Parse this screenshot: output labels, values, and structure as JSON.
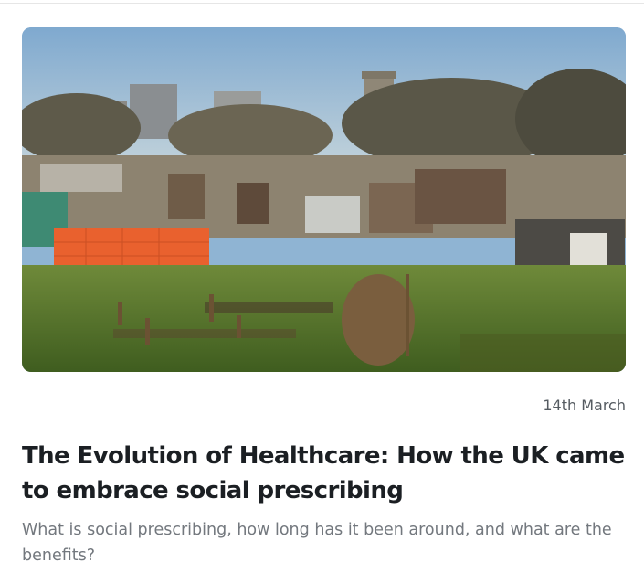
{
  "article": {
    "image_description_icon": "allotment-garden-photo",
    "date": "14th March",
    "title": "The Evolution of Healthcare: How the UK came to embrace social prescribing",
    "description": "What is social prescribing, how long has it been around, and what are the benefits?"
  },
  "colors": {
    "title": "#1b1f23",
    "description": "#73787e",
    "date": "#555b61"
  }
}
